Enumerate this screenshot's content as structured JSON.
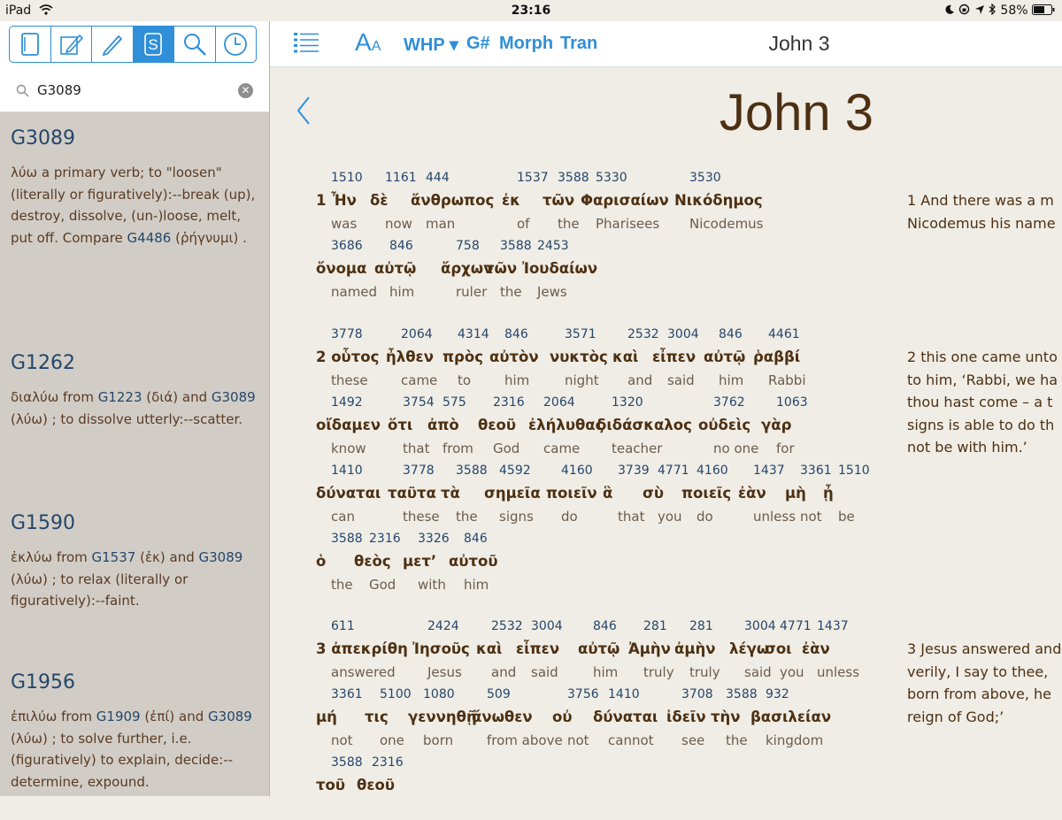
{
  "status": {
    "device": "iPad",
    "time": "23:16",
    "battery": "58%"
  },
  "sidebar": {
    "tools": [
      {
        "icon": "book-icon",
        "active": false
      },
      {
        "icon": "note-pencil-icon",
        "active": false
      },
      {
        "icon": "pencil-icon",
        "active": false
      },
      {
        "icon": "strongs-s-icon",
        "active": true
      },
      {
        "icon": "search-icon",
        "active": false
      },
      {
        "icon": "clock-icon",
        "active": false
      }
    ],
    "search": {
      "value": "G3089",
      "placeholder": ""
    },
    "entries": [
      {
        "id": "G3089",
        "text1": "λύω a primary verb; to \"loosen\" (literally or figuratively):--break (up), destroy, dissolve, (un-)loose, melt, put off. Compare ",
        "ref1": "G4486",
        "text2": " (ῥήγνυμι) .",
        "ref2": "",
        "text3": ""
      },
      {
        "id": "G1262",
        "text1": "διαλύω from ",
        "ref1": "G1223",
        "text2": " (διά) and ",
        "ref2": "G3089",
        "text3": " (λύω) ; to dissolve utterly:--scatter."
      },
      {
        "id": "G1590",
        "text1": "ἐκλύω from ",
        "ref1": "G1537",
        "text2": " (ἐκ) and ",
        "ref2": "G3089",
        "text3": " (λύω) ; to relax (literally or figuratively):--faint."
      },
      {
        "id": "G1956",
        "text1": "ἐπιλύω from ",
        "ref1": "G1909",
        "text2": " (ἐπί) and ",
        "ref2": "G3089",
        "text3": " (λύω) ; to solve further, i.e. (figuratively) to explain, decide:--determine, expound."
      }
    ]
  },
  "toolbar": {
    "font_big": "A",
    "font_small": "A",
    "whp": "WHP ▾",
    "gnum": "G#",
    "morph": "Morph",
    "tran": "Tran",
    "title": "John 3"
  },
  "chapter_title": "John 3",
  "verses": [
    {
      "num": "1",
      "lines": [
        [
          {
            "n": "1510",
            "g": "Ἦν",
            "e": "was"
          },
          {
            "n": "1161",
            "g": "δὲ",
            "e": "now"
          },
          {
            "n": "444",
            "g": "ἄνθρωπος",
            "e": "man"
          },
          {
            "n": "1537",
            "g": "ἐκ",
            "e": "of"
          },
          {
            "n": "3588",
            "g": "τῶν",
            "e": "the"
          },
          {
            "n": "5330",
            "g": "Φαρισαίων",
            "e": "Pharisees"
          },
          {
            "n": "3530",
            "g": "Νικόδημος",
            "e": "Nicodemus"
          }
        ],
        [
          {
            "n": "3686",
            "g": "ὄνομα",
            "e": "named"
          },
          {
            "n": "846",
            "g": "αὐτῷ",
            "e": "him"
          },
          {
            "n": "758",
            "g": "ἄρχων",
            "e": "ruler"
          },
          {
            "n": "3588",
            "g": "τῶν",
            "e": "the"
          },
          {
            "n": "2453",
            "g": "Ἰουδαίων",
            "e": "Jews"
          }
        ]
      ],
      "translation": [
        "1 And there was a m",
        "Nicodemus his name"
      ]
    },
    {
      "num": "2",
      "lines": [
        [
          {
            "n": "3778",
            "g": "οὗτος",
            "e": "these"
          },
          {
            "n": "2064",
            "g": "ἦλθεν",
            "e": "came"
          },
          {
            "n": "4314",
            "g": "πρὸς",
            "e": "to"
          },
          {
            "n": "846",
            "g": "αὐτὸν",
            "e": "him"
          },
          {
            "n": "3571",
            "g": "νυκτὸς",
            "e": "night"
          },
          {
            "n": "2532",
            "g": "καὶ",
            "e": "and"
          },
          {
            "n": "3004",
            "g": "εἶπεν",
            "e": "said"
          },
          {
            "n": "846",
            "g": "αὐτῷ",
            "e": "him"
          },
          {
            "n": "4461",
            "g": "ῥαββί",
            "e": "Rabbi"
          }
        ],
        [
          {
            "n": "1492",
            "g": "οἴδαμεν",
            "e": "know"
          },
          {
            "n": "3754",
            "g": "ὅτι",
            "e": "that"
          },
          {
            "n": "575",
            "g": "ἀπὸ",
            "e": "from"
          },
          {
            "n": "2316",
            "g": "θεοῦ",
            "e": "God"
          },
          {
            "n": "2064",
            "g": "ἐλήλυθας",
            "e": "came"
          },
          {
            "n": "1320",
            "g": "διδάσκαλος",
            "e": "teacher"
          },
          {
            "n": "3762",
            "g": "οὐδεὶς",
            "e": "no one"
          },
          {
            "n": "1063",
            "g": "γὰρ",
            "e": "for"
          }
        ],
        [
          {
            "n": "1410",
            "g": "δύναται",
            "e": "can"
          },
          {
            "n": "3778",
            "g": "ταῦτα",
            "e": "these"
          },
          {
            "n": "3588",
            "g": "τὰ",
            "e": "the"
          },
          {
            "n": "4592",
            "g": "σημεῖα",
            "e": "signs"
          },
          {
            "n": "4160",
            "g": "ποιεῖν",
            "e": "do"
          },
          {
            "n": "3739",
            "g": "ἃ",
            "e": "that"
          },
          {
            "n": "4771",
            "g": "σὺ",
            "e": "you"
          },
          {
            "n": "4160",
            "g": "ποιεῖς",
            "e": "do"
          },
          {
            "n": "1437",
            "g": "ἐὰν",
            "e": "unless"
          },
          {
            "n": "3361",
            "g": "μὴ",
            "e": "not"
          },
          {
            "n": "1510",
            "g": "ᾖ",
            "e": "be"
          }
        ],
        [
          {
            "n": "3588",
            "g": "ὁ",
            "e": "the"
          },
          {
            "n": "2316",
            "g": "θεὸς",
            "e": "God"
          },
          {
            "n": "3326",
            "g": "μετ’",
            "e": "with"
          },
          {
            "n": "846",
            "g": "αὐτοῦ",
            "e": "him"
          }
        ]
      ],
      "translation": [
        "2 this one came unto",
        "to him, ‘Rabbi, we ha",
        "thou hast come – a t",
        "signs is able to do th",
        "not be with him.’"
      ]
    },
    {
      "num": "3",
      "lines": [
        [
          {
            "n": "611",
            "g": "ἀπεκρίθη",
            "e": "answered"
          },
          {
            "n": "2424",
            "g": "Ἰησοῦς",
            "e": "Jesus"
          },
          {
            "n": "2532",
            "g": "καὶ",
            "e": "and"
          },
          {
            "n": "3004",
            "g": "εἶπεν",
            "e": "said"
          },
          {
            "n": "846",
            "g": "αὐτῷ",
            "e": "him"
          },
          {
            "n": "281",
            "g": "Ἀμὴν",
            "e": "truly"
          },
          {
            "n": "281",
            "g": "ἀμὴν",
            "e": "truly"
          },
          {
            "n": "3004",
            "g": "λέγω",
            "e": "said"
          },
          {
            "n": "4771",
            "g": "σοι",
            "e": "you"
          },
          {
            "n": "1437",
            "g": "ἐὰν",
            "e": "unless"
          }
        ],
        [
          {
            "n": "3361",
            "g": "μή",
            "e": "not"
          },
          {
            "n": "5100",
            "g": "τις",
            "e": "one"
          },
          {
            "n": "1080",
            "g": "γεννηθῇ",
            "e": "born"
          },
          {
            "n": "509",
            "g": "ἄνωθεν",
            "e": "from above"
          },
          {
            "n": "3756",
            "g": "οὐ",
            "e": "not"
          },
          {
            "n": "1410",
            "g": "δύναται",
            "e": "cannot"
          },
          {
            "n": "3708",
            "g": "ἰδεῖν",
            "e": "see"
          },
          {
            "n": "3588",
            "g": "τὴν",
            "e": "the"
          },
          {
            "n": "932",
            "g": "βασιλείαν",
            "e": "kingdom"
          }
        ],
        [
          {
            "n": "3588",
            "g": "τοῦ",
            "e": ""
          },
          {
            "n": "2316",
            "g": "θεοῦ",
            "e": ""
          }
        ]
      ],
      "translation": [
        "3 Jesus answered and",
        "verily, I say to thee,",
        "born from above, he",
        "reign of God;’"
      ]
    }
  ]
}
